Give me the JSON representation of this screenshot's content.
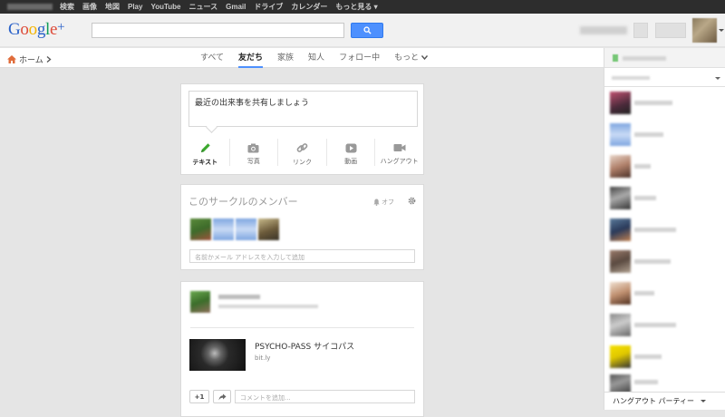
{
  "topbar": {
    "links": [
      "検索",
      "画像",
      "地図",
      "Play",
      "YouTube",
      "ニュース",
      "Gmail",
      "ドライブ",
      "カレンダー",
      "もっと見る ▾"
    ]
  },
  "logo": {
    "text": "Google+"
  },
  "nav": {
    "home": "ホーム",
    "tabs": [
      "すべて",
      "友だち",
      "家族",
      "知人",
      "フォロー中",
      "もっと"
    ],
    "active_tab": "友だち"
  },
  "share": {
    "placeholder": "最近の出来事を共有しましょう",
    "actions": [
      "テキスト",
      "写真",
      "リンク",
      "動画",
      "ハングアウト"
    ]
  },
  "members": {
    "title": "このサークルのメンバー",
    "off_label": "オフ",
    "input_placeholder": "名前かメール アドレスを入力して追加"
  },
  "post": {
    "link_title": "PSYCHO-PASS サイコパス",
    "link_domain": "bit.ly",
    "plus_one": "+1",
    "comment_placeholder": "コメントを追加..."
  },
  "sidebar": {
    "hangout_party": "ハングアウト パーティー"
  },
  "colors": {
    "accent": "#4d90fe",
    "pen_green": "#3ba82e"
  }
}
